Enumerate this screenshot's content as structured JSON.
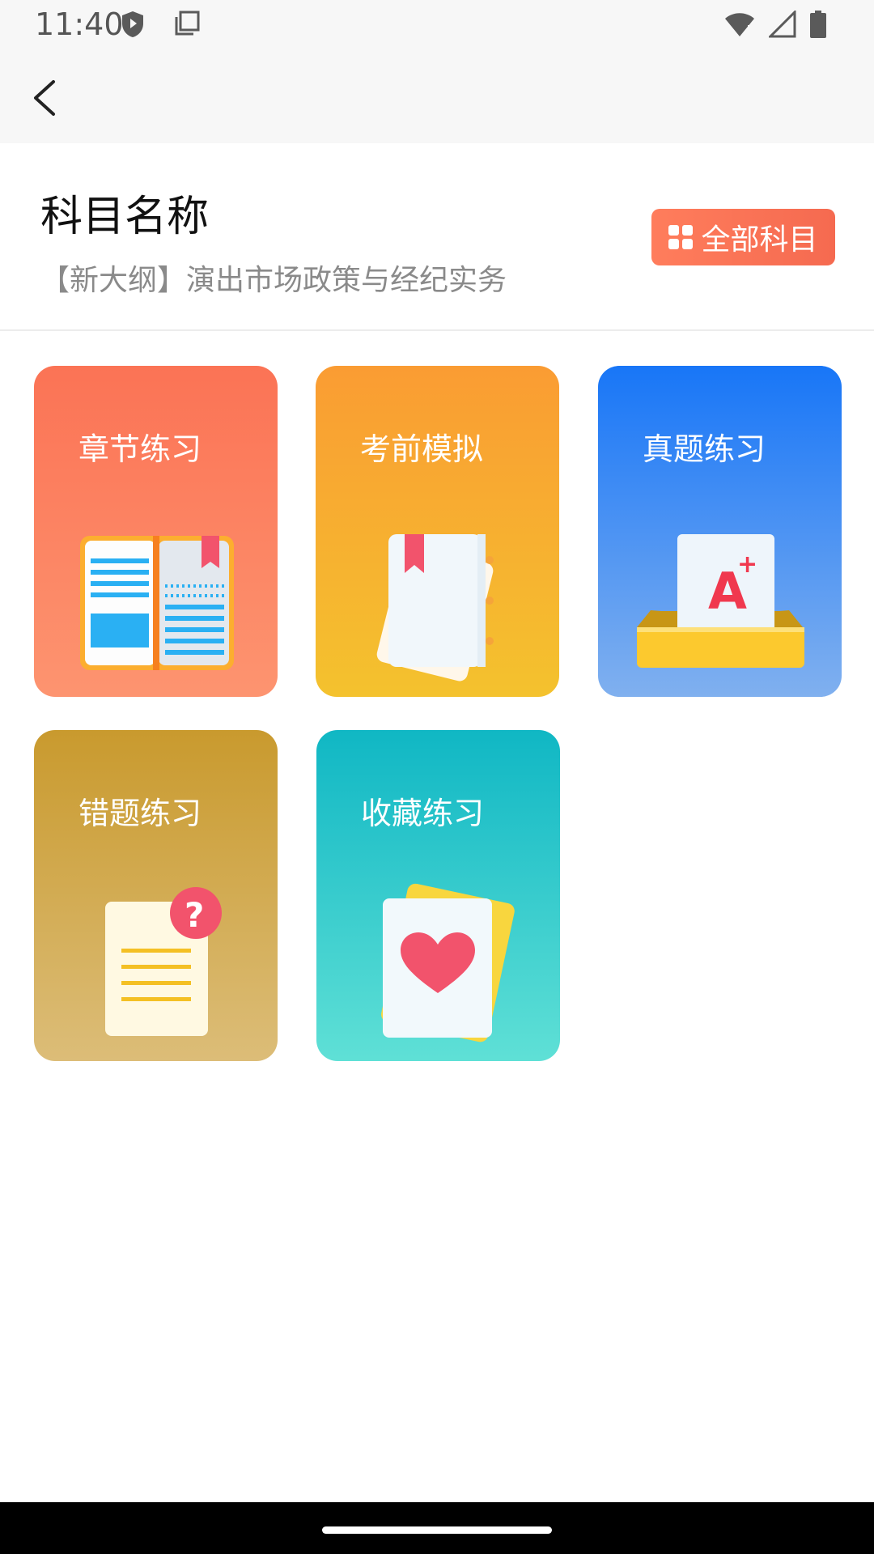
{
  "status_bar": {
    "time": "11:40"
  },
  "app_bar": {
    "back": "back"
  },
  "header": {
    "title": "科目名称",
    "subject": "【新大纲】演出市场政策与经纪实务",
    "all_subjects_label": "全部科目"
  },
  "cards": [
    {
      "label": "章节练习",
      "icon": "open-book-icon",
      "color": "#fb7355"
    },
    {
      "label": "考前模拟",
      "icon": "notebook-icon",
      "color": "#fa9c33"
    },
    {
      "label": "真题练习",
      "icon": "a-plus-paper-icon",
      "color": "#1876f7"
    },
    {
      "label": "错题练习",
      "icon": "question-document-icon",
      "color": "#c99a2e"
    },
    {
      "label": "收藏练习",
      "icon": "heart-card-icon",
      "color": "#10b7c4"
    }
  ]
}
